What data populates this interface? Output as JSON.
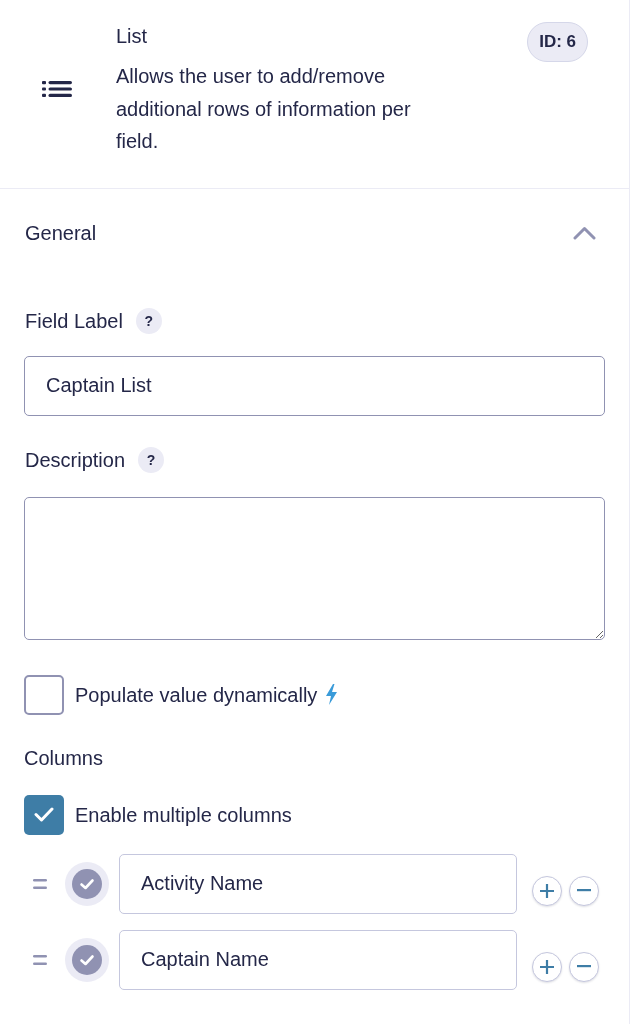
{
  "field_header": {
    "title": "List",
    "description": "Allows the user to add/remove additional rows of information per field.",
    "id_badge": "ID: 6"
  },
  "section": {
    "title": "General",
    "expanded": true
  },
  "field_label": {
    "label": "Field Label",
    "help": "?",
    "value": "Captain List"
  },
  "description_field": {
    "label": "Description",
    "help": "?"
  },
  "populate_dynamically": {
    "label": "Populate value dynamically",
    "checked": false
  },
  "columns": {
    "heading": "Columns",
    "enable_multiple": {
      "label": "Enable multiple columns",
      "checked": true
    },
    "items": [
      {
        "value": "Activity Name"
      },
      {
        "value": "Captain Name"
      }
    ]
  }
}
